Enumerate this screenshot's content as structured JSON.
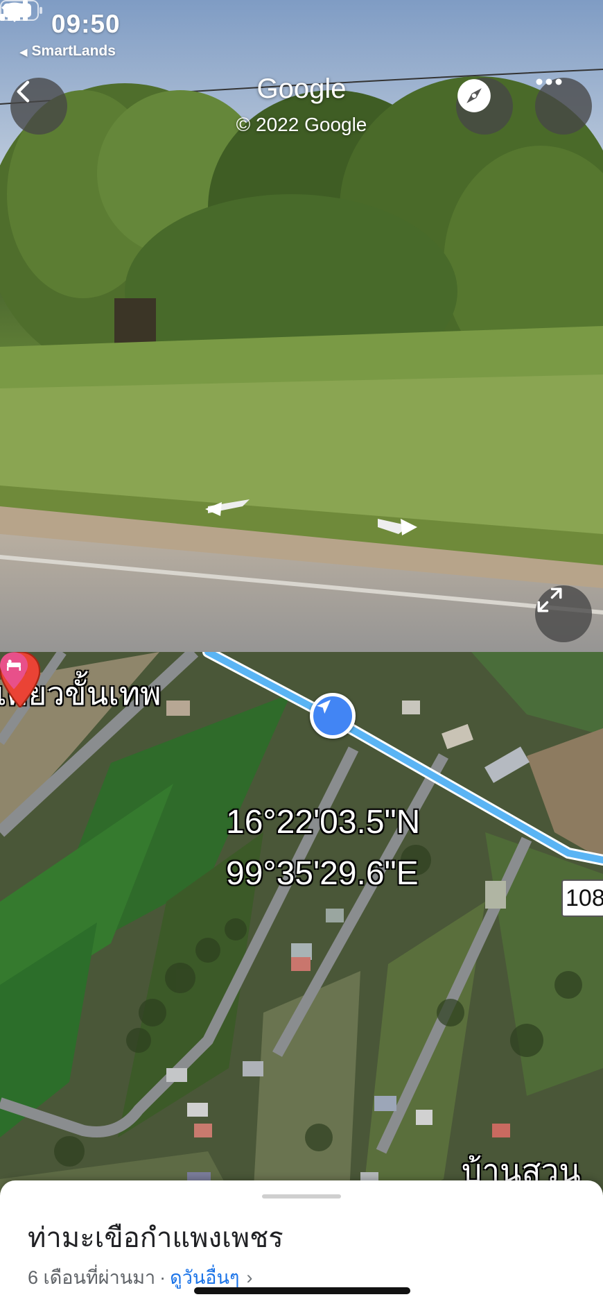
{
  "status_bar": {
    "time": "09:50",
    "back_app": "SmartLands"
  },
  "header": {
    "title": "Google",
    "copyright": "© 2022 Google"
  },
  "icons": {
    "back": "chevron-left-icon",
    "compass": "compass-icon",
    "more": "more-horizontal-icon",
    "expand": "expand-diagonal-icon",
    "nav_arrow": "navigation-arrow-icon",
    "pin": "map-pin-icon",
    "hotel": "hotel-pin-icon"
  },
  "map": {
    "place_label_top": "เคี้ยวขั้นเทพ",
    "coord_lat": "16°22'03.5\"N",
    "coord_lng": "99°35'29.6\"E",
    "route_number": "108",
    "place_label_bottom": "บ้านสวน"
  },
  "sheet": {
    "title": "ท่ามะเขือกำแพงเพชร",
    "date": "6 เดือนที่ผ่านมา",
    "separator": "·",
    "link": "ดูวันอื่นๆ",
    "chevron": "›"
  },
  "colors": {
    "accent_blue": "#4285f4",
    "link_blue": "#1a73e8",
    "pin_red": "#ea4335",
    "hotel_pink": "#e8508a"
  }
}
